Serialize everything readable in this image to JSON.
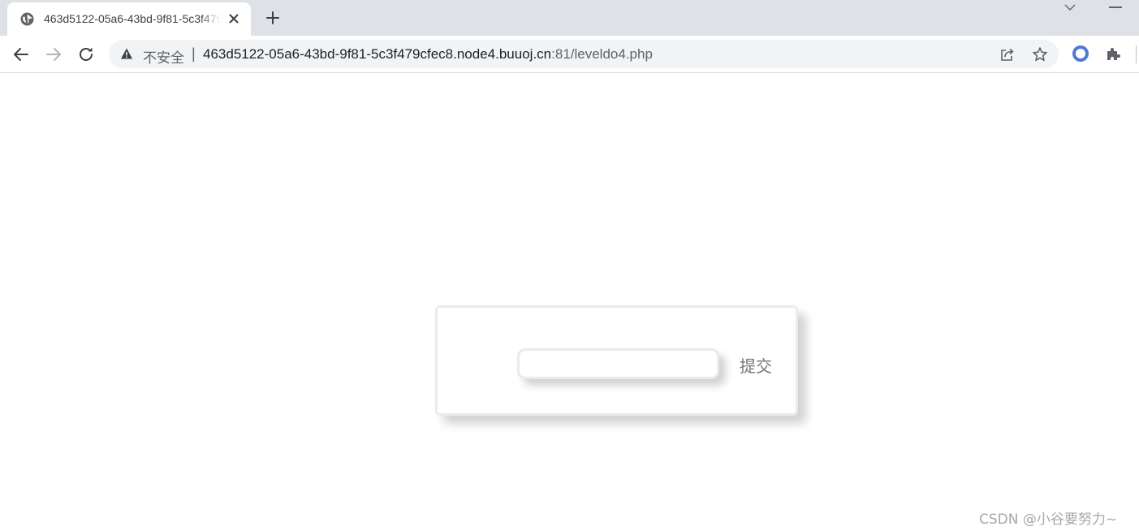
{
  "browser": {
    "tab": {
      "title": "463d5122-05a6-43bd-9f81-5c3f479cfec8.node4.buuoj.cn:81/leveldo4.php",
      "favicon": "globe-icon"
    },
    "address_bar": {
      "security_label": "不安全",
      "separator": "|",
      "url_host": "463d5122-05a6-43bd-9f81-5c3f479cfec8.node4.buuoj.cn",
      "url_rest": ":81/leveldo4.php"
    },
    "icons": {
      "back": "back-arrow-icon",
      "forward": "forward-arrow-icon",
      "reload": "reload-icon",
      "share": "share-icon",
      "bookmark": "star-icon",
      "extension_1": "circle-extension-icon",
      "extensions": "puzzle-icon"
    }
  },
  "page": {
    "input_value": "",
    "submit_label": "提交"
  },
  "watermark": "CSDN @小谷要努力~",
  "colors": {
    "tabstrip": "#dee1e6",
    "omnibox": "#f1f3f4",
    "extension_blue": "#4e7bd1"
  }
}
